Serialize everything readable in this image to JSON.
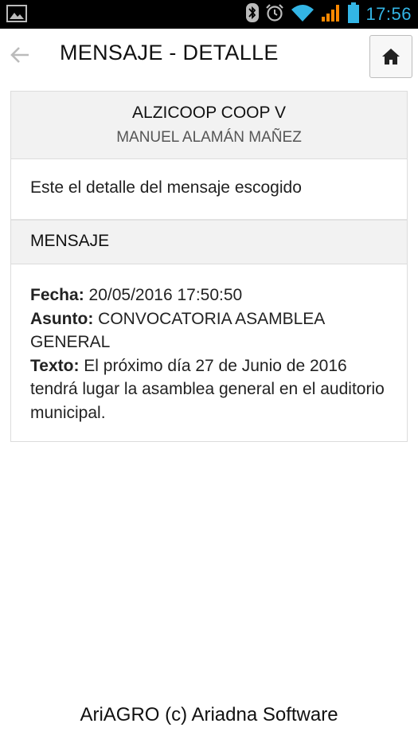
{
  "status_bar": {
    "time": "17:56",
    "icons": [
      "image-icon",
      "bluetooth-icon",
      "alarm-icon",
      "wifi-icon",
      "signal-icon",
      "battery-icon"
    ]
  },
  "header": {
    "title": "MENSAJE - DETALLE",
    "back_icon": "arrow-left-icon",
    "home_icon": "home-icon"
  },
  "card": {
    "company": "ALZICOOP COOP V",
    "user": "MANUEL ALAMÁN MAÑEZ",
    "intro": "Este el detalle del mensaje escogido",
    "section_title": "MENSAJE",
    "fields": {
      "fecha_label": "Fecha:",
      "fecha_value": "20/05/2016 17:50:50",
      "asunto_label": "Asunto:",
      "asunto_value": "CONVOCATORIA ASAMBLEA GENERAL",
      "texto_label": "Texto:",
      "texto_value": "El próximo día 27 de Junio de 2016 tendrá lugar la asamblea general en el auditorio municipal."
    }
  },
  "footer": {
    "text": "AriAGRO (c) Ariadna Software"
  },
  "colors": {
    "status_accent": "#33b5e5",
    "header_bg": "#ffffff",
    "card_header_bg": "#f2f2f2",
    "border": "#dcdcdc"
  }
}
